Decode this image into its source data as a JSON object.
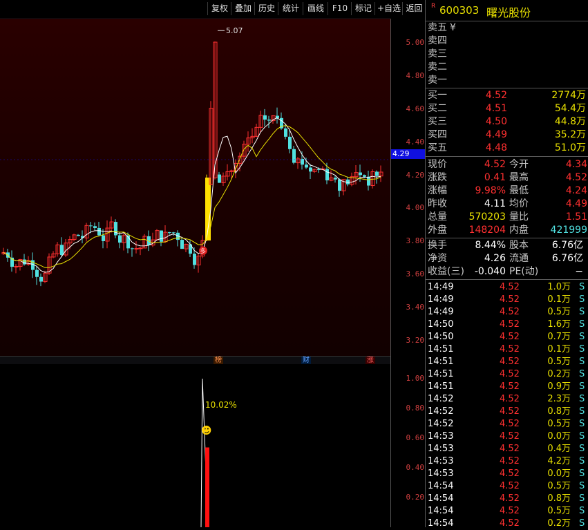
{
  "toolbar": {
    "buttons": [
      "复权",
      "叠加",
      "历史",
      "统计",
      "画线",
      "F10",
      "标记",
      "+自选",
      "返回"
    ]
  },
  "stock": {
    "badge": "R",
    "code": "600303",
    "name": "曙光股份"
  },
  "chart": {
    "price_ticks": [
      "5.00",
      "4.80",
      "4.60",
      "4.40",
      "4.20",
      "4.00",
      "3.80",
      "3.60",
      "3.40",
      "3.20"
    ],
    "current_price_tag": "4.29",
    "high_label": "5.07",
    "signal_label": "多",
    "event_tags": [
      "榜",
      "财",
      "涨"
    ],
    "colors": {
      "up": "#ff3030",
      "down": "#50e0e0",
      "ma5": "#ffffff",
      "ma10": "#e8e000",
      "limit_up": "#ffe000"
    }
  },
  "indicator": {
    "ticks": [
      "1.00",
      "0.80",
      "0.60",
      "0.40",
      "0.20"
    ],
    "peak_label": "10.02%",
    "peak_value": 1.0,
    "bar_value": 0.5,
    "icon": "smiley-icon"
  },
  "orderbook": {
    "sell": [
      {
        "label": "卖五",
        "mark": "¥",
        "price": "",
        "vol": ""
      },
      {
        "label": "卖四",
        "price": "",
        "vol": ""
      },
      {
        "label": "卖三",
        "price": "",
        "vol": ""
      },
      {
        "label": "卖二",
        "price": "",
        "vol": ""
      },
      {
        "label": "卖一",
        "price": "",
        "vol": ""
      }
    ],
    "buy": [
      {
        "label": "买一",
        "price": "4.52",
        "vol": "2774万"
      },
      {
        "label": "买二",
        "price": "4.51",
        "vol": "54.4万"
      },
      {
        "label": "买三",
        "price": "4.50",
        "vol": "44.8万"
      },
      {
        "label": "买四",
        "price": "4.49",
        "vol": "35.2万"
      },
      {
        "label": "买五",
        "price": "4.48",
        "vol": "51.0万"
      }
    ]
  },
  "quote": {
    "rows": [
      {
        "l1": "现价",
        "v1": "4.52",
        "l2": "今开",
        "v2": "4.34"
      },
      {
        "l1": "涨跌",
        "v1": "0.41",
        "l2": "最高",
        "v2": "4.52"
      },
      {
        "l1": "涨幅",
        "v1": "9.98%",
        "l2": "最低",
        "v2": "4.24"
      },
      {
        "l1": "昨收",
        "v1": "4.11",
        "l2": "均价",
        "v2": "4.49"
      },
      {
        "l1": "总量",
        "v1": "570203",
        "l2": "量比",
        "v2": "1.51"
      },
      {
        "l1": "外盘",
        "v1": "148204",
        "l2": "内盘",
        "v2": "421999"
      }
    ],
    "rows2": [
      {
        "l1": "换手",
        "v1": "8.44%",
        "l2": "股本",
        "v2": "6.76亿"
      },
      {
        "l1": "净资",
        "v1": "4.26",
        "l2": "流通",
        "v2": "6.76亿"
      },
      {
        "l1": "收益(三)",
        "v1": "-0.040",
        "l2": "PE(动)",
        "v2": "−"
      }
    ]
  },
  "ticks": [
    {
      "time": "14:49",
      "price": "4.52",
      "vol": "1.0万",
      "side": "S"
    },
    {
      "time": "14:49",
      "price": "4.52",
      "vol": "0.1万",
      "side": "S"
    },
    {
      "time": "14:49",
      "price": "4.52",
      "vol": "0.5万",
      "side": "S"
    },
    {
      "time": "14:50",
      "price": "4.52",
      "vol": "1.6万",
      "side": "S"
    },
    {
      "time": "14:50",
      "price": "4.52",
      "vol": "0.7万",
      "side": "S"
    },
    {
      "time": "14:51",
      "price": "4.52",
      "vol": "0.1万",
      "side": "S"
    },
    {
      "time": "14:51",
      "price": "4.52",
      "vol": "0.5万",
      "side": "S"
    },
    {
      "time": "14:51",
      "price": "4.52",
      "vol": "0.2万",
      "side": "S"
    },
    {
      "time": "14:51",
      "price": "4.52",
      "vol": "0.9万",
      "side": "S"
    },
    {
      "time": "14:52",
      "price": "4.52",
      "vol": "2.3万",
      "side": "S"
    },
    {
      "time": "14:52",
      "price": "4.52",
      "vol": "0.8万",
      "side": "S"
    },
    {
      "time": "14:52",
      "price": "4.52",
      "vol": "0.5万",
      "side": "S"
    },
    {
      "time": "14:53",
      "price": "4.52",
      "vol": "0.0万",
      "side": "S"
    },
    {
      "time": "14:53",
      "price": "4.52",
      "vol": "0.4万",
      "side": "S"
    },
    {
      "time": "14:53",
      "price": "4.52",
      "vol": "4.2万",
      "side": "S"
    },
    {
      "time": "14:53",
      "price": "4.52",
      "vol": "0.0万",
      "side": "S"
    },
    {
      "time": "14:54",
      "price": "4.52",
      "vol": "0.5万",
      "side": "S"
    },
    {
      "time": "14:54",
      "price": "4.52",
      "vol": "0.8万",
      "side": "S"
    },
    {
      "time": "14:54",
      "price": "4.52",
      "vol": "0.5万",
      "side": "S"
    },
    {
      "time": "14:54",
      "price": "4.52",
      "vol": "0.2万",
      "side": "S"
    }
  ]
}
